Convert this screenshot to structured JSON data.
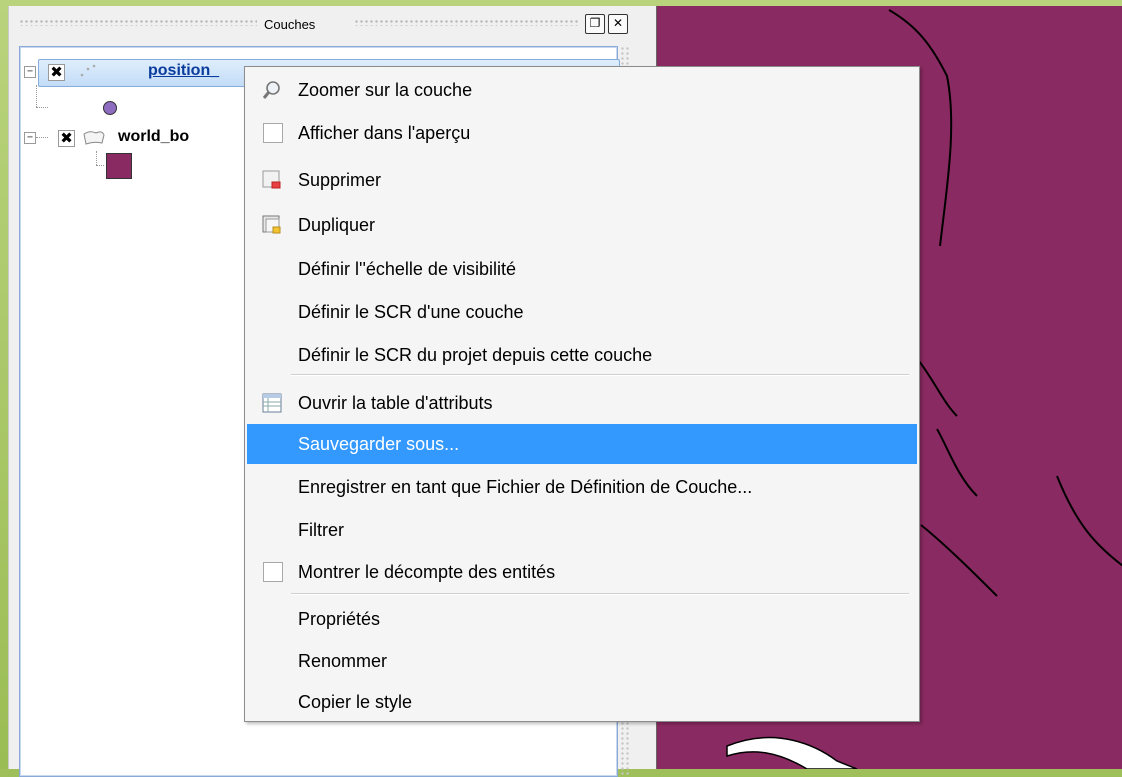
{
  "panel": {
    "title": "Couches"
  },
  "layers": [
    {
      "name": "position_",
      "checked": true,
      "symbol": "purple-circle-point",
      "geometry": "point"
    },
    {
      "name": "world_bo",
      "checked": true,
      "symbol": "purple-square-fill",
      "geometry": "polygon"
    }
  ],
  "colors": {
    "map_fill": "#8a2a62",
    "point_symbol": "#8e6cbf",
    "polygon_symbol": "#8a2a62",
    "menu_highlight": "#3399ff",
    "frame_green": "#9fbf5a"
  },
  "context_menu": {
    "items": [
      {
        "label": "Zoomer sur la couche",
        "mnemonic": "Z",
        "icon": "magnifier-icon"
      },
      {
        "label": "Afficher dans l'aperçu",
        "mnemonic": "A",
        "icon": "checkbox-icon",
        "checked": false
      },
      {
        "label": "Supprimer",
        "mnemonic": "S",
        "icon": "remove-layer-icon"
      },
      {
        "label": "Dupliquer",
        "mnemonic": "D",
        "icon": "duplicate-layer-icon"
      },
      {
        "label": "Définir l''échelle de visibilité"
      },
      {
        "label": "Définir le SCR d'une couche",
        "mnemonic": "S"
      },
      {
        "label": "Définir le SCR du projet depuis cette couche",
        "mnemonic": "p"
      },
      {
        "label": "Ouvrir la table d'attributs",
        "mnemonic": "O",
        "icon": "attribute-table-icon"
      },
      {
        "label": "Sauvegarder sous...",
        "highlighted": true
      },
      {
        "label": "Enregistrer en tant que Fichier de Définition de Couche..."
      },
      {
        "label": "Filtrer",
        "mnemonic": "F"
      },
      {
        "label": "Montrer le décompte des entités",
        "icon": "checkbox-icon",
        "checked": false
      },
      {
        "label": "Propriétés",
        "mnemonic": "P"
      },
      {
        "label": "Renommer",
        "mnemonic": "n"
      },
      {
        "label": "Copier le style"
      }
    ]
  }
}
